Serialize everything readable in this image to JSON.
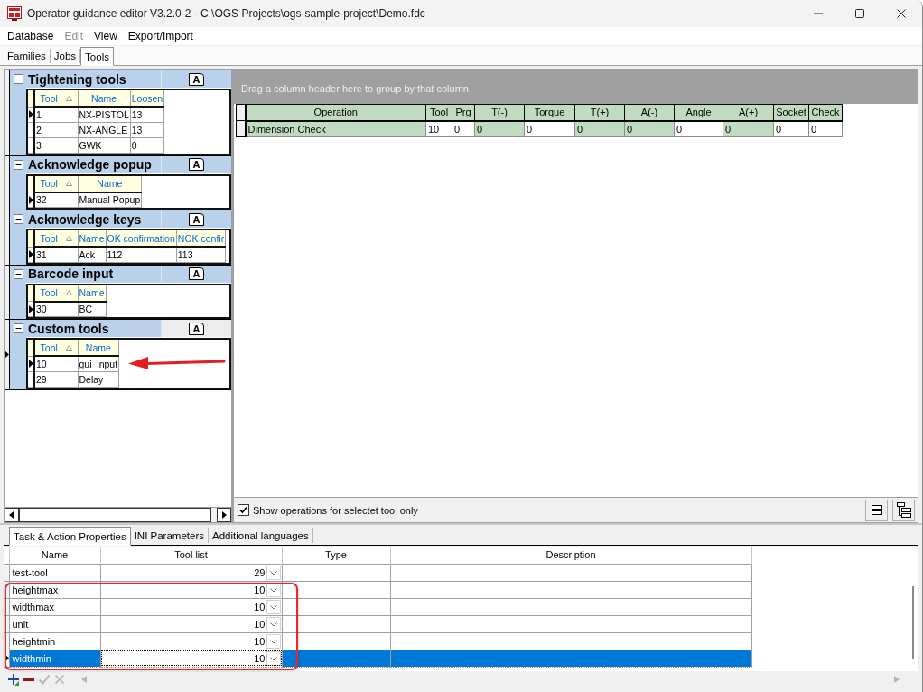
{
  "window": {
    "title": "Operator guidance editor V3.2.0-2 - C:\\OGS Projects\\ogs-sample-project\\Demo.fdc"
  },
  "menu": [
    {
      "label": "Database",
      "disabled": false
    },
    {
      "label": "Edit",
      "disabled": true
    },
    {
      "label": "View",
      "disabled": false
    },
    {
      "label": "Export/Import",
      "disabled": false
    }
  ],
  "tabs": [
    {
      "label": "Families",
      "selected": false
    },
    {
      "label": "Jobs",
      "selected": false
    },
    {
      "label": "Tools",
      "selected": true
    }
  ],
  "tool_groups": [
    {
      "title": "Tightening tools",
      "expanded": true,
      "selected": false,
      "format_button": "A",
      "columns": [
        {
          "label": "Tool",
          "sorted": true
        },
        {
          "label": "Name",
          "sorted": false
        },
        {
          "label": "Loosen",
          "sorted": false
        }
      ],
      "rows": [
        {
          "selected": true,
          "cells": [
            "1",
            "NX-PISTOL",
            "13"
          ]
        },
        {
          "selected": false,
          "cells": [
            "2",
            "NX-ANGLE",
            "13"
          ]
        },
        {
          "selected": false,
          "cells": [
            "3",
            "GWK",
            "0"
          ]
        }
      ]
    },
    {
      "title": "Acknowledge popup",
      "expanded": true,
      "selected": false,
      "format_button": "A",
      "columns": [
        {
          "label": "Tool",
          "sorted": true
        },
        {
          "label": "Name",
          "sorted": false
        }
      ],
      "rows": [
        {
          "selected": true,
          "cells": [
            "32",
            "Manual Popup"
          ]
        }
      ]
    },
    {
      "title": "Acknowledge keys",
      "expanded": true,
      "selected": false,
      "format_button": "A",
      "columns": [
        {
          "label": "Tool",
          "sorted": true
        },
        {
          "label": "Name",
          "sorted": false
        },
        {
          "label": "OK confirmation",
          "sorted": false
        },
        {
          "label": "NOK confir",
          "sorted": false
        }
      ],
      "rows": [
        {
          "selected": true,
          "cells": [
            "31",
            "Ack",
            "112",
            "113"
          ]
        }
      ]
    },
    {
      "title": "Barcode input",
      "expanded": true,
      "selected": false,
      "format_button": "A",
      "columns": [
        {
          "label": "Tool",
          "sorted": true
        },
        {
          "label": "Name",
          "sorted": false
        }
      ],
      "rows": [
        {
          "selected": true,
          "cells": [
            "30",
            "BC"
          ]
        }
      ]
    },
    {
      "title": "Custom tools",
      "expanded": true,
      "selected": true,
      "format_button": "A",
      "columns": [
        {
          "label": "Tool",
          "sorted": true
        },
        {
          "label": "Name",
          "sorted": false
        }
      ],
      "rows": [
        {
          "selected": true,
          "cells": [
            "10",
            "gui_input"
          ]
        },
        {
          "selected": false,
          "cells": [
            "29",
            "Delay"
          ]
        }
      ]
    }
  ],
  "operations": {
    "group_hint": "Drag a column header here to group by that column",
    "columns": [
      {
        "label": "Operation",
        "shaded": true
      },
      {
        "label": "Tool",
        "shaded": false
      },
      {
        "label": "Prg",
        "shaded": false
      },
      {
        "label": "T(-)",
        "shaded": true
      },
      {
        "label": "Torque",
        "shaded": false
      },
      {
        "label": "T(+)",
        "shaded": true
      },
      {
        "label": "A(-)",
        "shaded": true
      },
      {
        "label": "Angle",
        "shaded": false
      },
      {
        "label": "A(+)",
        "shaded": true
      },
      {
        "label": "Socket",
        "shaded": false
      },
      {
        "label": "Check",
        "shaded": false
      }
    ],
    "rows": [
      {
        "selected": false,
        "cells": [
          "Dimension Check",
          "10",
          "0",
          "0",
          "0",
          "0",
          "0",
          "0",
          "0",
          "0",
          "0"
        ]
      }
    ],
    "filter": {
      "label": "Show operations for selectet tool only",
      "checked": true
    }
  },
  "properties": {
    "tabs": [
      {
        "label": "Task & Action Properties",
        "selected": true
      },
      {
        "label": "INI Parameters",
        "selected": false
      },
      {
        "label": "Additional languages",
        "selected": false
      }
    ],
    "columns": [
      "Name",
      "Tool list",
      "Type",
      "Description"
    ],
    "rows": [
      {
        "name": "test-tool",
        "tool_list": "29",
        "selected": false
      },
      {
        "name": "heightmax",
        "tool_list": "10",
        "selected": false
      },
      {
        "name": "widthmax",
        "tool_list": "10",
        "selected": false
      },
      {
        "name": "unit",
        "tool_list": "10",
        "selected": false
      },
      {
        "name": "heightmin",
        "tool_list": "10",
        "selected": false
      },
      {
        "name": "widthmin",
        "tool_list": "10",
        "selected": true
      }
    ],
    "navigator": [
      {
        "kind": "add",
        "disabled": false
      },
      {
        "kind": "delete",
        "disabled": false
      },
      {
        "kind": "confirm",
        "disabled": true
      },
      {
        "kind": "cancel",
        "disabled": true
      }
    ]
  },
  "annotations": [
    {
      "kind": "arrow"
    },
    {
      "kind": "outline"
    }
  ]
}
